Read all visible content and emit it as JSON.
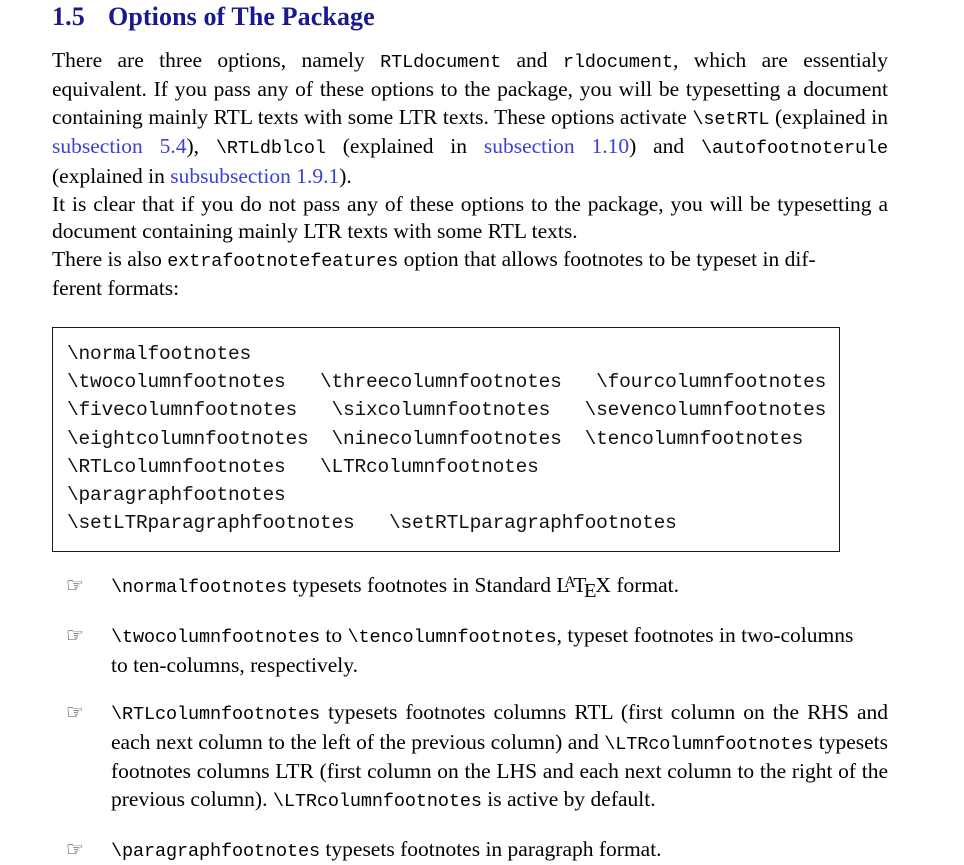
{
  "heading": {
    "number": "1.5",
    "title": "Options of The Package"
  },
  "paragraphs": {
    "p1": {
      "t1": "There are three options, namely ",
      "c1": "RTLdocument",
      "t2": " and ",
      "c2": "rldocument",
      "t3": ", which are essentialy equivalent.  If you pass any of these options to the package, you will be typesetting a document containing mainly RTL texts with some LTR texts.  These options activate ",
      "c3": "\\setRTL",
      "t4": " (explained in ",
      "link1": "subsection 5.4",
      "t5": "), ",
      "c4": "\\RTLdblcol",
      "t6": " (explained in ",
      "link2": "subsection 1.10",
      "t7": ") and ",
      "c5": "\\autofootnoterule",
      "t8": " (explained in ",
      "link3": "subsubsection 1.9.1",
      "t9": ")."
    },
    "p2": "It is clear that if you do not pass any of these options to the package, you will be typesetting a document containing mainly LTR texts with some RTL texts.",
    "p3": {
      "t1": "There is also ",
      "c1": "extrafootnotefeatures",
      "t2": " option that allows footnotes to be typeset in dif-",
      "t3": "ferent formats:"
    }
  },
  "codebox": {
    "lines": [
      "\\normalfootnotes",
      "\\twocolumnfootnotes   \\threecolumnfootnotes   \\fourcolumnfootnotes",
      "\\fivecolumnfootnotes   \\sixcolumnfootnotes   \\sevencolumnfootnotes",
      "\\eightcolumnfootnotes  \\ninecolumnfootnotes  \\tencolumnfootnotes",
      "\\RTLcolumnfootnotes   \\LTRcolumnfootnotes",
      "\\paragraphfootnotes",
      "\\setLTRparagraphfootnotes   \\setRTLparagraphfootnotes"
    ],
    "text": "\\normalfootnotes\n\\twocolumnfootnotes   \\threecolumnfootnotes   \\fourcolumnfootnotes\n\\fivecolumnfootnotes   \\sixcolumnfootnotes   \\sevencolumnfootnotes\n\\eightcolumnfootnotes  \\ninecolumnfootnotes  \\tencolumnfootnotes\n\\RTLcolumnfootnotes   \\LTRcolumnfootnotes\n\\paragraphfootnotes\n\\setLTRparagraphfootnotes   \\setRTLparagraphfootnotes"
  },
  "bullets": {
    "marker": "☞",
    "items": [
      {
        "c1": "\\normalfootnotes",
        "t1": " typesets footnotes in Standard ",
        "logo": "LaTeX",
        "t2": " format."
      },
      {
        "c1": "\\twocolumnfootnotes",
        "t1": " to ",
        "c2": "\\tencolumnfootnotes",
        "t2": ", typeset footnotes in two-columns",
        "t3": "to ten-columns, respectively."
      },
      {
        "c1": "\\RTLcolumnfootnotes",
        "t1": " typesets footnotes columns RTL (first column on the RHS and each next column to the left of the previous column) and ",
        "c2": "\\LTRcolumnfootnotes",
        "t2": " typesets footnotes columns LTR (first column on the LHS and each next column to the right of the previous column).  ",
        "c3": "\\LTRcolumnfootnotes",
        "t3": " is active by default."
      },
      {
        "c1": "\\paragraphfootnotes",
        "t1": " typesets footnotes in paragraph format."
      }
    ]
  },
  "colors": {
    "heading": "#1a1a8c",
    "link": "#3a41d6",
    "text": "#000000",
    "border": "#1a1a1a"
  }
}
